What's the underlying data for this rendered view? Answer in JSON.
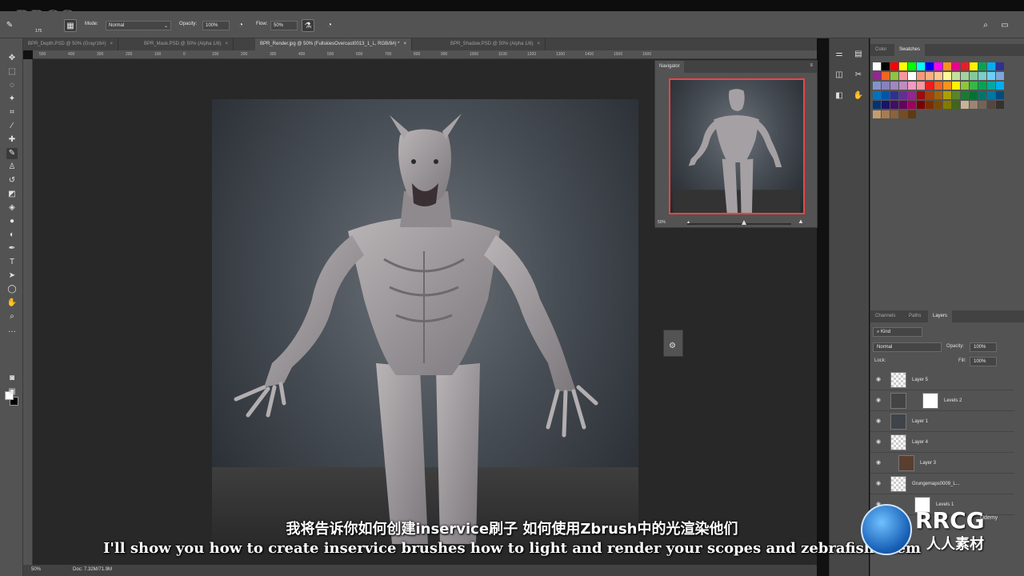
{
  "watermark": {
    "logo": "RRCG",
    "corner_brand": "RRCG",
    "corner_cn": "人人素材",
    "platform": "Udemy"
  },
  "options_bar": {
    "brush_size": "175",
    "mode_label": "Mode:",
    "mode_value": "Normal",
    "opacity_label": "Opacity:",
    "opacity_value": "100%",
    "flow_label": "Flow:",
    "flow_value": "50%"
  },
  "tabs": [
    {
      "label": "BPR_Depth.PSD @ 50% (Gray/16#)",
      "active": false
    },
    {
      "label": "BPR_Mask.PSD @ 50% (Alpha 1/8)",
      "active": false
    },
    {
      "label": "BPR_Render.jpg @ 50% (FullskiesOvercast0013_1_L, RGB/8#) *",
      "active": true
    },
    {
      "label": "BPR_Shadow.PSD @ 50% (Alpha 1/8)",
      "active": false
    }
  ],
  "tab_close": "×",
  "ruler_marks": [
    "500",
    "400",
    "300",
    "200",
    "100",
    "0",
    "100",
    "200",
    "300",
    "400",
    "500",
    "600",
    "700",
    "800",
    "900",
    "1000",
    "1100",
    "1200",
    "1300",
    "1400",
    "1500",
    "1600"
  ],
  "navigator": {
    "title": "Navigator",
    "zoom": "50%"
  },
  "color_panel": {
    "tabs": [
      "Color",
      "Swatches"
    ]
  },
  "swatch_colors": [
    "#ffffff",
    "#000000",
    "#ff0000",
    "#ffff00",
    "#00ff00",
    "#00ffff",
    "#0000ff",
    "#ff00ff",
    "#f7941d",
    "#ec008c",
    "#ed1c24",
    "#fff200",
    "#00a651",
    "#00aeef",
    "#2e3192",
    "#92278f",
    "#f26522",
    "#8dc63f",
    "#f5989d",
    "#ffffff",
    "#f7977a",
    "#fbad82",
    "#fdc68c",
    "#fff79a",
    "#c4df9b",
    "#a2d39c",
    "#82ca9d",
    "#7bcdc8",
    "#6ecff6",
    "#7ea7d8",
    "#8393ca",
    "#8781bd",
    "#a187be",
    "#bc8dbf",
    "#f49ac2",
    "#f6989d",
    "#ee1d24",
    "#f26522",
    "#f7941d",
    "#fff200",
    "#8dc63f",
    "#39b54a",
    "#00a651",
    "#00a99d",
    "#00aeef",
    "#0072bc",
    "#0054a6",
    "#2e3192",
    "#662d91",
    "#92278f",
    "#9e0b0f",
    "#a0410d",
    "#a36209",
    "#aba000",
    "#598527",
    "#1a7b30",
    "#007236",
    "#00746b",
    "#0076a3",
    "#004b80",
    "#003471",
    "#1b1464",
    "#440e62",
    "#630460",
    "#9e005d",
    "#790000",
    "#7b2e00",
    "#7d4900",
    "#827b00",
    "#406618",
    "#c7b299",
    "#998675",
    "#736357",
    "#534741",
    "#37302d",
    "#c69c6d",
    "#a67c52",
    "#8c6239",
    "#754c24",
    "#603913"
  ],
  "layers_panel": {
    "tabs": [
      "Channels",
      "Paths",
      "Layers"
    ],
    "kind": "Kind",
    "blend": "Normal",
    "opacity_label": "Opacity:",
    "opacity_value": "100%",
    "lock_label": "Lock:",
    "fill_label": "Fill:",
    "fill_value": "100%",
    "layers": [
      {
        "name": "Layer 5"
      },
      {
        "name": "Levels 2"
      },
      {
        "name": "Layer 1"
      },
      {
        "name": "Layer 4"
      },
      {
        "name": "Layer 3"
      },
      {
        "name": "Grungemaps0009_L..."
      },
      {
        "name": "Levels 1"
      }
    ]
  },
  "status": {
    "zoom": "50%",
    "doc": "Doc: 7.32M/71.9M"
  },
  "subtitles": {
    "cn": "我将告诉你如何创建inservice刷子 如何使用Zbrush中的光渲染他们",
    "en": "I'll show you how to create inservice brushes how to light and render your scopes and zebrafish them"
  }
}
